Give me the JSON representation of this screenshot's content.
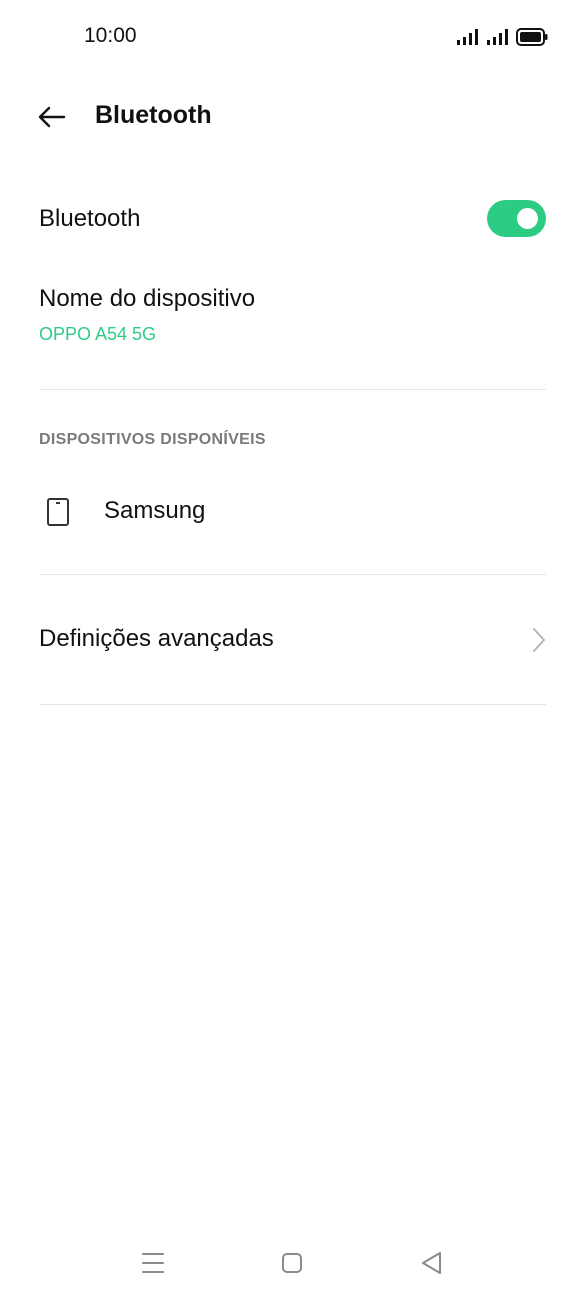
{
  "status_bar": {
    "time": "10:00"
  },
  "header": {
    "title": "Bluetooth"
  },
  "bluetooth_row": {
    "label": "Bluetooth",
    "enabled": true
  },
  "device_name_row": {
    "label": "Nome do dispositivo",
    "value": "OPPO A54 5G"
  },
  "available_section": {
    "heading": "DISPOSITIVOS DISPONÍVEIS",
    "devices": [
      {
        "name": "Samsung",
        "icon": "phone-icon"
      }
    ]
  },
  "advanced_row": {
    "label": "Definições avançadas"
  },
  "colors": {
    "accent": "#2dcc85",
    "divider": "#e6e6e6",
    "section_heading": "#7a7a7a"
  },
  "nav_bar": {
    "icons": [
      "menu-icon",
      "home-icon",
      "back-triangle-icon"
    ]
  }
}
